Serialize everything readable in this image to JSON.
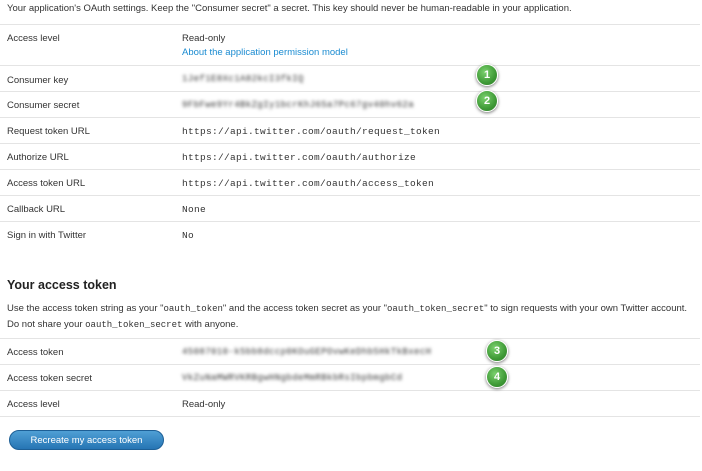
{
  "intro": "Your application's OAuth settings. Keep the \"Consumer secret\" a secret. This key should never be human-readable in your application.",
  "settings": [
    {
      "label": "Access level",
      "value": "Read-only",
      "link": "About the application permission model"
    },
    {
      "label": "Consumer key",
      "value": "1Jef1E8Xc1A82kcI3fkIQ",
      "secret": true,
      "badge": "1"
    },
    {
      "label": "Consumer secret",
      "value": "9FbFwe9Yr4BkZgIy1bcrKhJ65a7Pc67gv40hv62a",
      "secret": true,
      "badge": "2"
    },
    {
      "label": "Request token URL",
      "value": "https://api.twitter.com/oauth/request_token"
    },
    {
      "label": "Authorize URL",
      "value": "https://api.twitter.com/oauth/authorize"
    },
    {
      "label": "Access token URL",
      "value": "https://api.twitter.com/oauth/access_token"
    },
    {
      "label": "Callback URL",
      "value": "None"
    },
    {
      "label": "Sign in with Twitter",
      "value": "No"
    }
  ],
  "access": {
    "title": "Your access token",
    "para": {
      "p1": "Use the access token string as your \"",
      "code1": "oauth_token",
      "p2": "\" and the access token secret as your \"",
      "code2": "oauth_token_secret",
      "p3": "\" to sign requests with your own Twitter account. Do not share your ",
      "code3": "oauth_token_secret",
      "p4": " with anyone."
    },
    "rows": [
      {
        "label": "Access token",
        "value": "45087010-k5bb8dccp0KOuGEPOvwKeDhb5HkTkBxecH",
        "secret": true,
        "badge": "3"
      },
      {
        "label": "Access token secret",
        "value": "VkZuNaMWRVKRBgwHNgbdeMmRBkbRsIbpbmgbCd",
        "secret": true,
        "badge": "4"
      },
      {
        "label": "Access level",
        "value": "Read-only"
      }
    ],
    "button": "Recreate my access token"
  },
  "colors": {
    "link": "#1a8bd1",
    "badge": "#3f9a37",
    "button": "#2675b4"
  }
}
